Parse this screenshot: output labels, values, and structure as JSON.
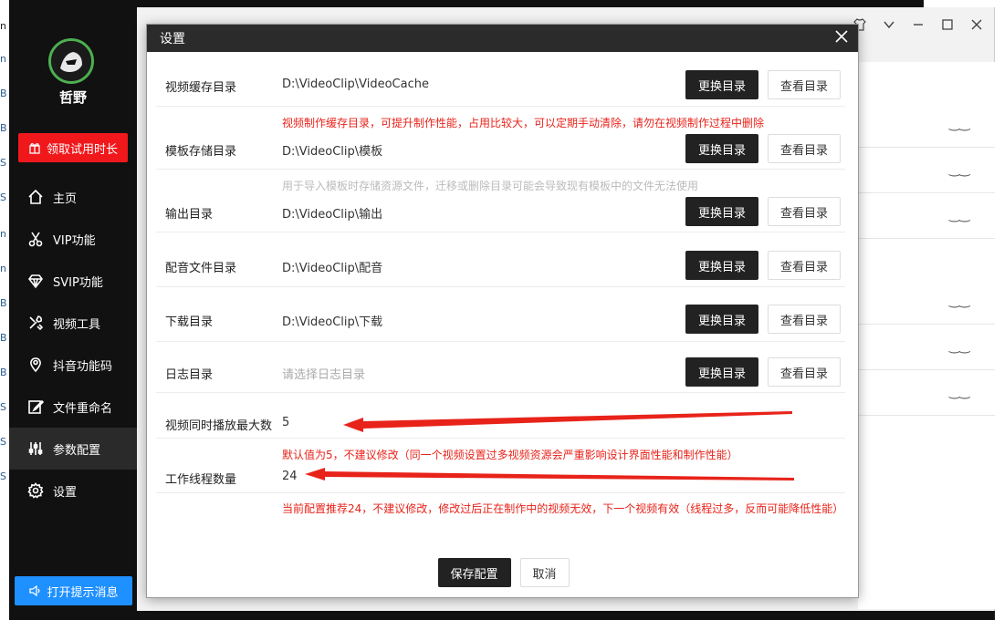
{
  "sidebar": {
    "username": "哲野",
    "trial_label": "领取试用时长",
    "notify_label": "打开提示消息",
    "items": [
      {
        "label": "主页",
        "icon": "home-icon"
      },
      {
        "label": "VIP功能",
        "icon": "scissors-icon"
      },
      {
        "label": "SVIP功能",
        "icon": "diamond-icon"
      },
      {
        "label": "视频工具",
        "icon": "tools-icon"
      },
      {
        "label": "抖音功能码",
        "icon": "location-icon"
      },
      {
        "label": "文件重命名",
        "icon": "edit-icon"
      },
      {
        "label": "参数配置",
        "icon": "sliders-icon"
      },
      {
        "label": "设置",
        "icon": "gear-icon"
      }
    ],
    "active_index": 6
  },
  "modal": {
    "title": "设置",
    "change_label": "更换目录",
    "view_label": "查看目录",
    "rows": [
      {
        "label": "视频缓存目录",
        "value": "D:\\VideoClip\\VideoCache",
        "note": "视频制作缓存目录，可提升制作性能，占用比较大，可以定期手动清除，请勿在视频制作过程中删除"
      },
      {
        "label": "模板存储目录",
        "value": "D:\\VideoClip\\模板",
        "note": "用于导入模板时存储资源文件，迁移或删除目录可能会导致现有模板中的文件无法使用"
      },
      {
        "label": "输出目录",
        "value": "D:\\VideoClip\\输出"
      },
      {
        "label": "配音文件目录",
        "value": "D:\\VideoClip\\配音"
      },
      {
        "label": "下载目录",
        "value": "D:\\VideoClip\\下载"
      },
      {
        "label": "日志目录",
        "placeholder": "请选择日志目录"
      }
    ],
    "max_play": {
      "label": "视频同时播放最大数",
      "value": "5",
      "note": "默认值为5，不建议修改（同一个视频设置过多视频资源会严重影响设计界面性能和制作性能）"
    },
    "threads": {
      "label": "工作线程数量",
      "value": "24",
      "note": "当前配置推荐24，不建议修改，修改过后正在制作中的视频无效，下一个视频有效（线程过多，反而可能降低性能）"
    },
    "save_label": "保存配置",
    "cancel_label": "取消"
  },
  "colors": {
    "sidebar_bg": "#111111",
    "trial_red": "#f0181b",
    "notify_blue": "#1e90ff",
    "note_red": "#e8231a",
    "arrow_red": "#e8231a"
  }
}
